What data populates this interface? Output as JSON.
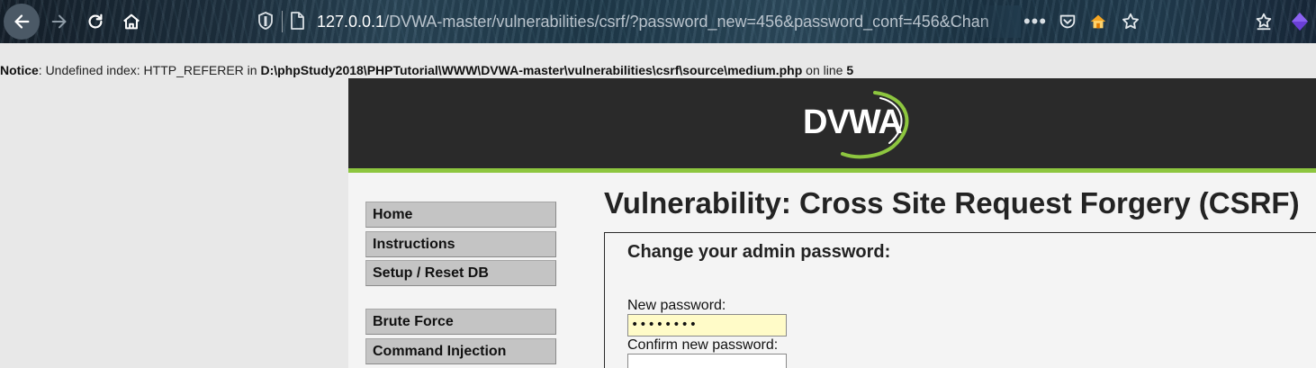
{
  "browser": {
    "url_host": "127.0.0.1",
    "url_path": "/DVWA-master/vulnerabilities/csrf/?password_new=456&password_conf=456&Chan",
    "more_label": "•••",
    "icons": {
      "back": "arrow-left-icon",
      "forward": "arrow-right-icon",
      "reload": "reload-icon",
      "home": "home-icon",
      "shield": "shield-icon",
      "page": "page-icon",
      "pocket": "pocket-icon",
      "homebase": "homebase-icon",
      "star": "star-icon",
      "bookmarks": "bookmarks-icon",
      "extension": "extension-icon"
    }
  },
  "notice": {
    "label": "Notice",
    "message": ": Undefined index: HTTP_REFERER in ",
    "path": "D:\\phpStudy2018\\PHPTutorial\\WWW\\DVWA-master\\vulnerabilities\\csrf\\source\\medium.php",
    "line_text": " on line ",
    "line_number": "5"
  },
  "header": {
    "logo_text": "DVWA",
    "accent_color": "#8dc63f"
  },
  "menu": {
    "items": [
      {
        "label": "Home"
      },
      {
        "label": "Instructions"
      },
      {
        "label": "Setup / Reset DB"
      },
      {
        "label": "Brute Force"
      },
      {
        "label": "Command Injection"
      }
    ]
  },
  "main": {
    "title": "Vulnerability: Cross Site Request Forgery (CSRF)",
    "heading": "Change your admin password:",
    "new_password_label": "New password:",
    "new_password_value": "••••••••",
    "confirm_password_label": "Confirm new password:",
    "confirm_password_value": ""
  }
}
